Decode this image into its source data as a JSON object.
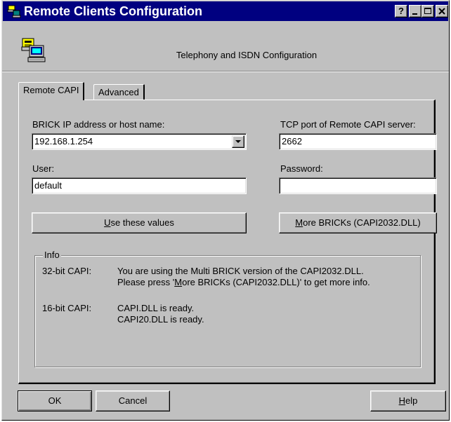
{
  "window": {
    "title": "Remote Clients Configuration"
  },
  "title_buttons": {
    "help": "?",
    "minimize": "_",
    "maximize": "□",
    "close": "×"
  },
  "header": {
    "title": "Telephony and ISDN Configuration",
    "icon": "telephone-computer-icon"
  },
  "tabs": [
    {
      "label": "Remote CAPI",
      "selected": true
    },
    {
      "label": "Advanced",
      "selected": false
    }
  ],
  "form": {
    "host_label": "BRICK IP address or host name:",
    "host_value": "192.168.1.254",
    "port_label": "TCP port of Remote CAPI server:",
    "port_value": "2662",
    "user_label": "User:",
    "user_value": "default",
    "password_label": "Password:",
    "password_value": ""
  },
  "buttons": {
    "use_values_pre": "",
    "use_values_key": "U",
    "use_values_post": "se these values",
    "more_pre": "",
    "more_key": "M",
    "more_post": "ore BRICKs (CAPI2032.DLL)",
    "ok": "OK",
    "cancel": "Cancel",
    "help_key": "H",
    "help_post": "elp"
  },
  "info": {
    "legend": "Info",
    "row1_label": "32-bit CAPI:",
    "row1_line1": "You are using the Multi BRICK version of the CAPI2032.DLL.",
    "row1_line2_pre": "Please press '",
    "row1_line2_key": "M",
    "row1_line2_post": "ore BRICKs (CAPI2032.DLL)' to get more info.",
    "row2_label": "16-bit CAPI:",
    "row2_line1": "CAPI.DLL is ready.",
    "row2_line2": "CAPI20.DLL is ready."
  },
  "colors": {
    "titlebar": "#000080",
    "face": "#c0c0c0",
    "field": "#ffffff"
  }
}
